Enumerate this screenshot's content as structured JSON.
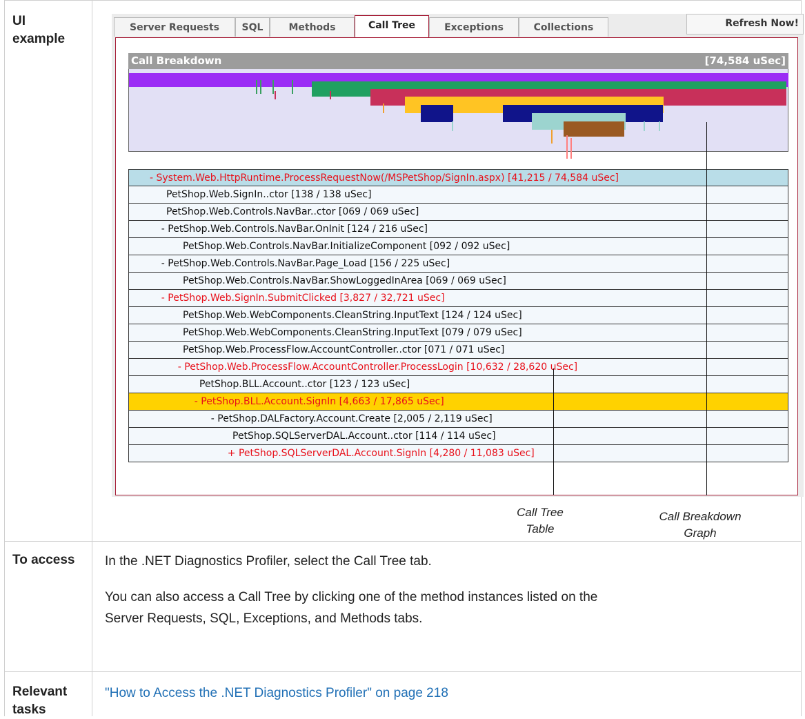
{
  "rows": {
    "ui_example_label": "UI example",
    "to_access_label": "To access",
    "relevant_tasks_label": "Relevant tasks"
  },
  "screenshot": {
    "tabs": [
      "Server Requests",
      "SQL",
      "Methods",
      "Call Tree",
      "Exceptions",
      "Collections"
    ],
    "active_tab": "Call Tree",
    "refresh_button": "Refresh Now!",
    "call_breakdown": {
      "title": "Call Breakdown",
      "total": "[74,584 uSec]",
      "colors": {
        "purple": "#9b2cf5",
        "green": "#20a060",
        "crimson": "#c8305a",
        "gold": "#ffc423",
        "navy": "#10148a",
        "teal": "#9cd4cf",
        "brown": "#9a5a22",
        "background": "#e2e0f5"
      }
    },
    "call_tree": [
      {
        "text": "- System.Web.HttpRuntime.ProcessRequestNow(/MSPetShop/SignIn.aspx) [41,215 / 74,584 uSec]",
        "indent": 1,
        "hot": true,
        "selected": false
      },
      {
        "text": "PetShop.Web.SignIn..ctor [138 / 138 uSec]",
        "indent": 2,
        "hot": false,
        "selected": false
      },
      {
        "text": "PetShop.Web.Controls.NavBar..ctor [069 / 069 uSec]",
        "indent": 2,
        "hot": false,
        "selected": false
      },
      {
        "text": "- PetShop.Web.Controls.NavBar.OnInit [124 / 216 uSec]",
        "indent": 1.7,
        "hot": false,
        "selected": false
      },
      {
        "text": "PetShop.Web.Controls.NavBar.InitializeComponent [092 / 092 uSec]",
        "indent": 3,
        "hot": false,
        "selected": false
      },
      {
        "text": "- PetShop.Web.Controls.NavBar.Page_Load [156 / 225 uSec]",
        "indent": 1.7,
        "hot": false,
        "selected": false
      },
      {
        "text": "PetShop.Web.Controls.NavBar.ShowLoggedInArea [069 / 069 uSec]",
        "indent": 3,
        "hot": false,
        "selected": false
      },
      {
        "text": "- PetShop.Web.SignIn.SubmitClicked [3,827 / 32,721 uSec]",
        "indent": 1.7,
        "hot": true,
        "selected": false
      },
      {
        "text": "PetShop.Web.WebComponents.CleanString.InputText [124 / 124 uSec]",
        "indent": 3,
        "hot": false,
        "selected": false
      },
      {
        "text": "PetShop.Web.WebComponents.CleanString.InputText [079 / 079 uSec]",
        "indent": 3,
        "hot": false,
        "selected": false
      },
      {
        "text": "PetShop.Web.ProcessFlow.AccountController..ctor [071 / 071 uSec]",
        "indent": 3,
        "hot": false,
        "selected": false
      },
      {
        "text": "- PetShop.Web.ProcessFlow.AccountController.ProcessLogin [10,632 / 28,620 uSec]",
        "indent": 2.7,
        "hot": true,
        "selected": false
      },
      {
        "text": "PetShop.BLL.Account..ctor [123 / 123 uSec]",
        "indent": 4,
        "hot": false,
        "selected": false
      },
      {
        "text": "- PetShop.BLL.Account.SignIn [4,663 / 17,865 uSec]",
        "indent": 3.7,
        "hot": true,
        "selected": true
      },
      {
        "text": "- PetShop.DALFactory.Account.Create [2,005 / 2,119 uSec]",
        "indent": 4.7,
        "hot": false,
        "selected": false
      },
      {
        "text": "PetShop.SQLServerDAL.Account..ctor [114 / 114 uSec]",
        "indent": 6,
        "hot": false,
        "selected": false
      },
      {
        "text": "+ PetShop.SQLServerDAL.Account.SignIn [4,280 / 11,083 uSec]",
        "indent": 5.7,
        "hot": true,
        "selected": false
      }
    ],
    "annotations": {
      "call_tree_table": [
        "Call Tree",
        "Table"
      ],
      "call_breakdown_graph": [
        "Call  Breakdown",
        "Graph"
      ]
    }
  },
  "to_access": {
    "line1": "In the .NET Diagnostics Profiler, select the Call Tree tab.",
    "line2a": "You can also access a Call Tree by clicking one of the method instances listed on the",
    "line2b": "Server Requests, SQL, Exceptions, and Methods tabs."
  },
  "relevant_tasks": {
    "link": "\"How to Access the .NET Diagnostics Profiler\" on page 218"
  }
}
